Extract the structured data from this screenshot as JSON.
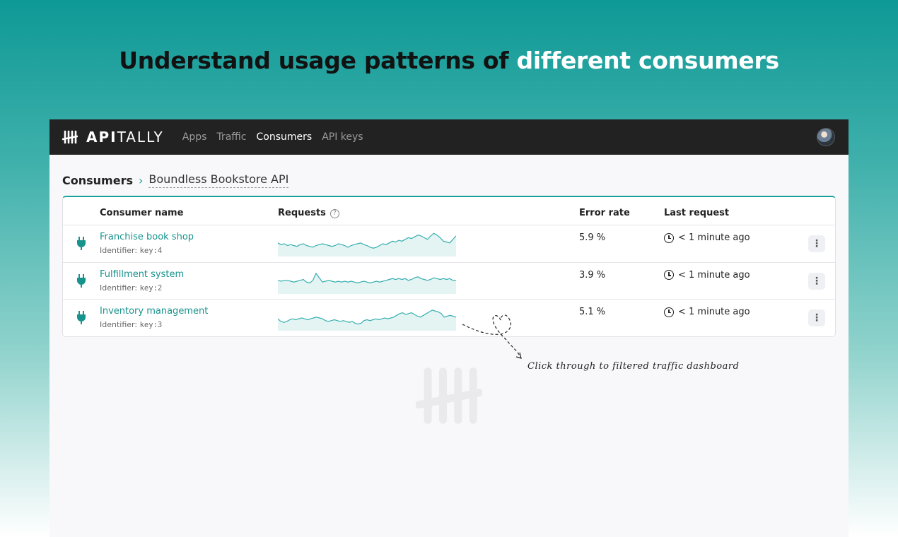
{
  "headline": {
    "main": "Understand usage patterns of ",
    "accent": "different consumers"
  },
  "navbar": {
    "logo_bold": "API",
    "logo_rest": "TALLY",
    "items": [
      "Apps",
      "Traffic",
      "Consumers",
      "API keys"
    ],
    "active_item": "Consumers"
  },
  "breadcrumb": {
    "root": "Consumers",
    "separator": "›",
    "current": "Boundless Bookstore API"
  },
  "table": {
    "headers": {
      "name": "Consumer name",
      "requests": "Requests",
      "error_rate": "Error rate",
      "last_request": "Last request"
    },
    "rows": [
      {
        "name": "Franchise book shop",
        "identifier_label": "Identifier: ",
        "identifier": "key:4",
        "error_rate": "5.9 %",
        "last_request": "< 1 minute ago",
        "sparkline": [
          14,
          12,
          13,
          11,
          12,
          11,
          10,
          12,
          13,
          11,
          10,
          9,
          11,
          12,
          13,
          12,
          11,
          10,
          11,
          13,
          12,
          11,
          9,
          11,
          12,
          13,
          14,
          12,
          11,
          9,
          8,
          9,
          11,
          13,
          12,
          14,
          16,
          15,
          17,
          16,
          18,
          20,
          19,
          21,
          23,
          22,
          20,
          18,
          22,
          25,
          23,
          20,
          16,
          15,
          14,
          18,
          22
        ]
      },
      {
        "name": "Fulfillment system",
        "identifier_label": "Identifier: ",
        "identifier": "key:2",
        "error_rate": "3.9 %",
        "last_request": "< 1 minute ago",
        "sparkline": [
          14,
          13,
          14,
          14,
          13,
          12,
          13,
          14,
          15,
          12,
          11,
          14,
          22,
          17,
          12,
          13,
          14,
          13,
          12,
          13,
          12,
          13,
          12,
          13,
          12,
          11,
          12,
          13,
          12,
          11,
          12,
          13,
          12,
          13,
          14,
          15,
          16,
          15,
          16,
          15,
          16,
          14,
          15,
          17,
          18,
          16,
          15,
          14,
          15,
          17,
          16,
          15,
          16,
          15,
          16,
          14,
          14
        ]
      },
      {
        "name": "Inventory management",
        "identifier_label": "Identifier: ",
        "identifier": "key:3",
        "error_rate": "5.1 %",
        "last_request": "< 1 minute ago",
        "sparkline": [
          12,
          9,
          8,
          9,
          11,
          12,
          11,
          12,
          13,
          12,
          11,
          12,
          13,
          14,
          13,
          12,
          10,
          9,
          10,
          11,
          10,
          9,
          10,
          9,
          8,
          9,
          7,
          6,
          7,
          10,
          11,
          10,
          11,
          12,
          11,
          12,
          13,
          12,
          13,
          14,
          16,
          18,
          19,
          17,
          18,
          19,
          17,
          15,
          14,
          16,
          18,
          20,
          22,
          21,
          20,
          18,
          14,
          15,
          16,
          15,
          14
        ]
      }
    ]
  },
  "annotation": "Click through to filtered traffic dashboard",
  "colors": {
    "accent": "#17a39c",
    "sparkline_fill": "#e4f4f3",
    "sparkline_stroke": "#36aeb0",
    "navbar": "#222222"
  },
  "icons": {
    "consumer": "plug-icon",
    "help": "help-circle-icon",
    "time": "clock-icon",
    "menu": "more-vertical-icon"
  }
}
